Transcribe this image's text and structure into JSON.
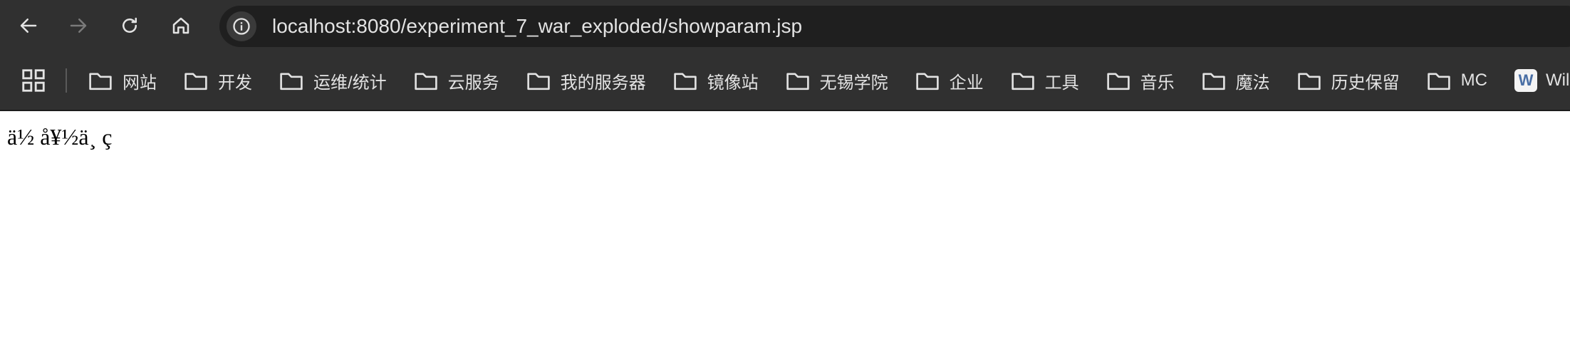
{
  "toolbar": {
    "back_icon": "arrow-left-icon",
    "forward_icon": "arrow-right-icon",
    "reload_icon": "reload-icon",
    "home_icon": "home-icon",
    "site_info_icon": "info-icon",
    "url": "localhost:8080/experiment_7_war_exploded/showparam.jsp"
  },
  "bookmarks": {
    "apps_icon": "apps-grid-icon",
    "items": [
      {
        "label": "网站",
        "icon": "folder-icon"
      },
      {
        "label": "开发",
        "icon": "folder-icon"
      },
      {
        "label": "运维/统计",
        "icon": "folder-icon"
      },
      {
        "label": "云服务",
        "icon": "folder-icon"
      },
      {
        "label": "我的服务器",
        "icon": "folder-icon"
      },
      {
        "label": "镜像站",
        "icon": "folder-icon"
      },
      {
        "label": "无锡学院",
        "icon": "folder-icon"
      },
      {
        "label": "企业",
        "icon": "folder-icon"
      },
      {
        "label": "工具",
        "icon": "folder-icon"
      },
      {
        "label": "音乐",
        "icon": "folder-icon"
      },
      {
        "label": "魔法",
        "icon": "folder-icon"
      },
      {
        "label": "历史保留",
        "icon": "folder-icon"
      },
      {
        "label": "MC",
        "icon": "folder-icon"
      }
    ],
    "last_item": {
      "label": "WildC",
      "badge": "W"
    }
  },
  "page": {
    "body_text": "ä½ å¥½ä¸ ç"
  },
  "colors": {
    "toolbar_bg": "#303030",
    "omnibox_bg": "#1f1f1f",
    "text_light": "#e3e3e3",
    "icon_disabled": "#7a7a7a"
  }
}
